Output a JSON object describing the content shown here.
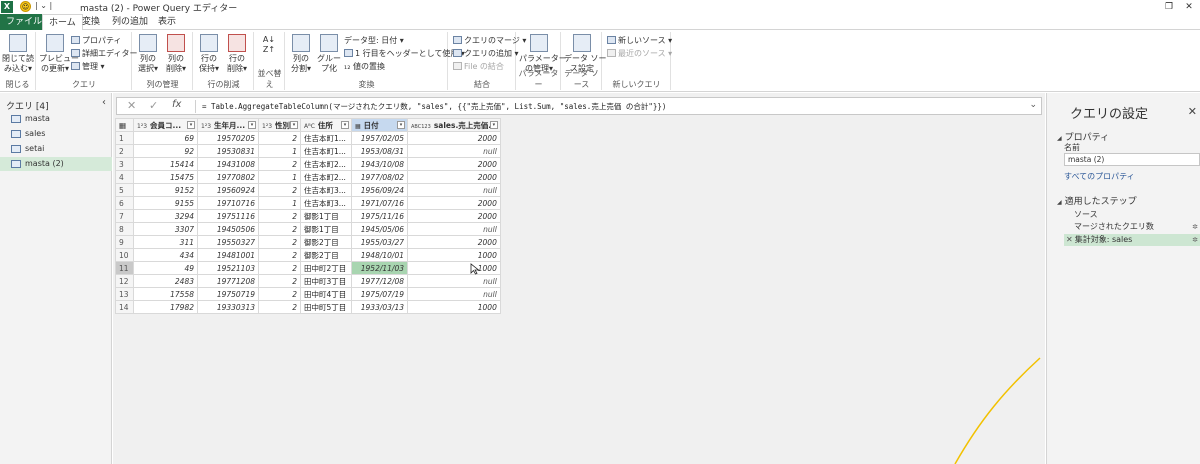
{
  "titlebar": {
    "title": "masta (2) - Power Query エディター",
    "qa_separator": "| ⌄ |",
    "restore_glyph": "❐",
    "close_glyph": "✕"
  },
  "tabs": [
    {
      "label": "ファイル"
    },
    {
      "label": "ホーム"
    },
    {
      "label": "変換"
    },
    {
      "label": "列の追加"
    },
    {
      "label": "表示"
    }
  ],
  "ribbon": {
    "groups": {
      "close": "閉じる",
      "query": "クエリ",
      "manage_columns": "列の管理",
      "reduce_rows": "行の削減",
      "sort": "並べ替え",
      "transform": "変換",
      "combine": "結合",
      "parameters": "パラメーター",
      "datasource": "データ ソース",
      "new_query": "新しいクエリ"
    },
    "close_apply": "閉じて読\nみ込む▾",
    "preview_refresh": "プレビュー\nの更新▾",
    "properties": "プロパティ",
    "advanced_editor": "詳細エディター",
    "manage": "管理 ▾",
    "choose_columns": "列の\n選択▾",
    "remove_columns": "列の\n削除▾",
    "keep_rows": "行の\n保持▾",
    "remove_rows": "行の\n削除▾",
    "sort_icon_text": "A↓\nZ↑",
    "split_column": "列の\n分割▾",
    "group_by": "グルー\nプ化",
    "data_type": "データ型: 日付 ▾",
    "first_row_header": "1 行目をヘッダーとして使用 ▾",
    "replace_values": "₁₂ 値の置換",
    "merge_queries": "クエリのマージ ▾",
    "append_queries": "クエリの追加 ▾",
    "combine_files": "File の結合",
    "manage_params": "パラメーター\nの管理▾",
    "datasource_settings": "データ ソー\nス設定",
    "new_source": "新しいソース ▾",
    "recent_sources": "最近のソース ▾"
  },
  "left_panel": {
    "header": "クエリ [4]",
    "collapse_glyph": "‹",
    "queries": [
      {
        "label": "masta",
        "selected": false
      },
      {
        "label": "sales",
        "selected": false
      },
      {
        "label": "setai",
        "selected": false
      },
      {
        "label": "masta (2)",
        "selected": true
      }
    ]
  },
  "formula_bar": {
    "cancel": "✕",
    "confirm": "✓",
    "fx": "fx",
    "formula": "= Table.AggregateTableColumn(マージされたクエリ数, \"sales\", {{\"売上売価\", List.Sum, \"sales.売上売価 の合計\"}})",
    "dropdown": "⌄"
  },
  "table": {
    "columns": [
      {
        "type": "1²3",
        "name": "会員コ..."
      },
      {
        "type": "1²3",
        "name": "生年月..."
      },
      {
        "type": "1²3",
        "name": "性別"
      },
      {
        "type": "AᴮC",
        "name": "住所"
      },
      {
        "type": "▦",
        "name": "日付"
      },
      {
        "type": "ABC123",
        "name": "sales.売上売価..."
      }
    ],
    "rows": [
      {
        "n": "1",
        "c": [
          "69",
          "19570205",
          "2",
          "住吉本町1...",
          "1957/02/05",
          "2000"
        ]
      },
      {
        "n": "2",
        "c": [
          "92",
          "19530831",
          "1",
          "住吉本町1...",
          "1953/08/31",
          "null"
        ]
      },
      {
        "n": "3",
        "c": [
          "15414",
          "19431008",
          "2",
          "住吉本町2...",
          "1943/10/08",
          "2000"
        ]
      },
      {
        "n": "4",
        "c": [
          "15475",
          "19770802",
          "1",
          "住吉本町2...",
          "1977/08/02",
          "2000"
        ]
      },
      {
        "n": "5",
        "c": [
          "9152",
          "19560924",
          "2",
          "住吉本町3...",
          "1956/09/24",
          "null"
        ]
      },
      {
        "n": "6",
        "c": [
          "9155",
          "19710716",
          "1",
          "住吉本町3...",
          "1971/07/16",
          "2000"
        ]
      },
      {
        "n": "7",
        "c": [
          "3294",
          "19751116",
          "2",
          "御影1丁目",
          "1975/11/16",
          "2000"
        ]
      },
      {
        "n": "8",
        "c": [
          "3307",
          "19450506",
          "2",
          "御影1丁目",
          "1945/05/06",
          "null"
        ]
      },
      {
        "n": "9",
        "c": [
          "311",
          "19550327",
          "2",
          "御影2丁目",
          "1955/03/27",
          "2000"
        ]
      },
      {
        "n": "10",
        "c": [
          "434",
          "19481001",
          "2",
          "御影2丁目",
          "1948/10/01",
          "1000"
        ]
      },
      {
        "n": "11",
        "c": [
          "49",
          "19521103",
          "2",
          "田中町2丁目",
          "1952/11/03",
          "1000"
        ]
      },
      {
        "n": "12",
        "c": [
          "2483",
          "19771208",
          "2",
          "田中町3丁目",
          "1977/12/08",
          "null"
        ]
      },
      {
        "n": "13",
        "c": [
          "17558",
          "19750719",
          "2",
          "田中町4丁目",
          "1975/07/19",
          "null"
        ]
      },
      {
        "n": "14",
        "c": [
          "17982",
          "19330313",
          "2",
          "田中町5丁目",
          "1933/03/13",
          "1000"
        ]
      }
    ]
  },
  "right_panel": {
    "title": "クエリの設定",
    "close_glyph": "✕",
    "properties_header": "プロパティ",
    "name_label": "名前",
    "name_value": "masta (2)",
    "all_properties": "すべてのプロパティ",
    "steps_header": "適用したステップ",
    "steps": [
      {
        "label": "ソース",
        "gear": false,
        "selected": false
      },
      {
        "label": "マージされたクエリ数",
        "gear": true,
        "selected": false
      },
      {
        "label": "集計対象: sales",
        "gear": true,
        "selected": true
      }
    ],
    "gear_glyph": "✲",
    "delete_glyph": "✕"
  },
  "colors": {
    "accent_green": "#217346",
    "selection_green": "#a8d5b0",
    "annotation_stroke": "#f2c100"
  }
}
